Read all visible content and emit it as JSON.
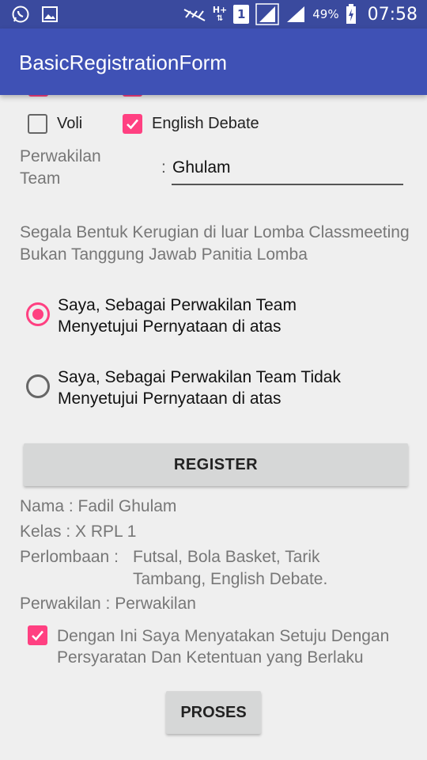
{
  "status_bar": {
    "battery_percent": "49%",
    "time": "07:58",
    "network_type": "H+",
    "sim_slot": "1",
    "icons": [
      "whatsapp-icon",
      "gallery-icon",
      "mute-icon",
      "network-hplus-icon",
      "sim-1-icon",
      "signal-icon",
      "signal-icon-2",
      "battery-charging-icon"
    ]
  },
  "app_bar": {
    "title": "BasicRegistrationForm"
  },
  "competitions": {
    "items": [
      {
        "label": "Voli",
        "checked": false
      },
      {
        "label": "English Debate",
        "checked": true
      }
    ]
  },
  "representative": {
    "label": "Perwakilan Team",
    "colon": ":",
    "value": "Ghulam"
  },
  "disclaimer": {
    "line1": "Segala Bentuk Kerugian di luar Lomba Classmeeting",
    "line2": "Bukan Tanggung Jawab Panitia Lomba"
  },
  "statement": {
    "options": [
      {
        "line1": "Saya, Sebagai Perwakilan Team",
        "line2": "Menyetujui Pernyataan di atas",
        "selected": true
      },
      {
        "line1": "Saya, Sebagai Perwakilan Team Tidak",
        "line2": "Menyetujui Pernyataan di atas",
        "selected": false
      }
    ]
  },
  "buttons": {
    "register": "REGISTER",
    "proses": "PROSES"
  },
  "result": {
    "nama": "Nama : Fadil Ghulam",
    "kelas": "Kelas : X RPL 1",
    "perlombaan_key": "Perlombaan :",
    "perlombaan_value": "Futsal, Bola Basket, Tarik Tambang, English Debate.",
    "perwakilan": "Perwakilan : Perwakilan"
  },
  "agreement": {
    "checked": true,
    "text": "Dengan Ini Saya Menyatakan Setuju Dengan Persyaratan Dan Ketentuan yang Berlaku"
  },
  "colors": {
    "primary": "#3f51b5",
    "status_bar": "#3a4a9e",
    "accent": "#ff4081",
    "background": "#efefef"
  }
}
